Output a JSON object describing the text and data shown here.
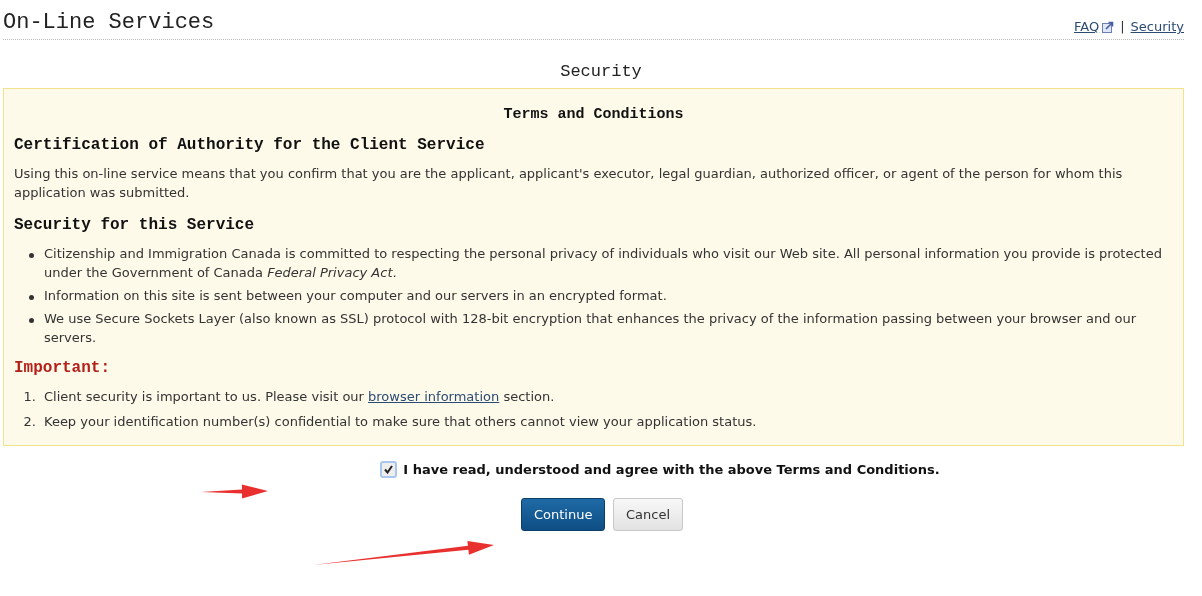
{
  "header": {
    "title": "On-Line Services",
    "separator": "|",
    "links": [
      {
        "label": "FAQ",
        "external": true
      },
      {
        "label": "Security",
        "external": false
      }
    ]
  },
  "page_title": "Security",
  "terms": {
    "title": "Terms and Conditions",
    "sections": [
      {
        "heading": "Certification of Authority for the Client Service",
        "kind": "paragraph",
        "text": "Using this on-line service means that you confirm that you are the applicant, applicant's executor, legal guardian, authorized officer, or agent of the person for whom this application was submitted."
      },
      {
        "heading": "Security for this Service",
        "kind": "bullets",
        "items": [
          {
            "text": "Citizenship and Immigration Canada is committed to respecting the personal privacy of individuals who visit our Web site. All personal information you provide is protected under the Government of Canada *Federal Privacy Act*."
          },
          {
            "text": "Information on this site is sent between your computer and our servers in an encrypted format."
          },
          {
            "text": "We use Secure Sockets Layer (also known as SSL) protocol with 128-bit encryption that enhances the privacy of the information passing between your browser and our servers."
          }
        ]
      }
    ],
    "important": {
      "heading": "Important:",
      "items": [
        {
          "marker": "1.",
          "before": "Client security is important to us. Please visit our ",
          "link": "browser information",
          "after": " section."
        },
        {
          "marker": "2.",
          "before": "Keep your identification number(s) confidential to make sure that others cannot view your application status."
        }
      ]
    }
  },
  "agree": {
    "label": "I have read, understood and agree with the above Terms and Conditions.",
    "checked": true
  },
  "buttons": [
    {
      "label": "Continue",
      "kind": "primary"
    },
    {
      "label": "Cancel",
      "kind": "secondary"
    }
  ]
}
